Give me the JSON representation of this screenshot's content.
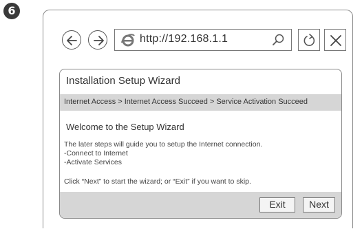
{
  "step": {
    "number": "6"
  },
  "browser": {
    "url": "http://192.168.1.1"
  },
  "wizard": {
    "title": "Installation Setup Wizard",
    "breadcrumb": "Internet Access > Internet Access Succeed > Service Activation Succeed",
    "welcome_title": "Welcome to the Setup Wizard",
    "lines": [
      "The later steps will guide you to setup the Internet connection.",
      "-Connect to Internet",
      "-Activate Services",
      "Click “Next” to start the wizard; or “Exit” if you want to skip."
    ],
    "exit_label": "Exit",
    "next_label": "Next"
  },
  "icons": {
    "back": "arrow-left-icon",
    "forward": "arrow-right-icon",
    "browser": "ie-icon",
    "search": "search-icon",
    "refresh": "refresh-icon",
    "close": "close-icon"
  }
}
